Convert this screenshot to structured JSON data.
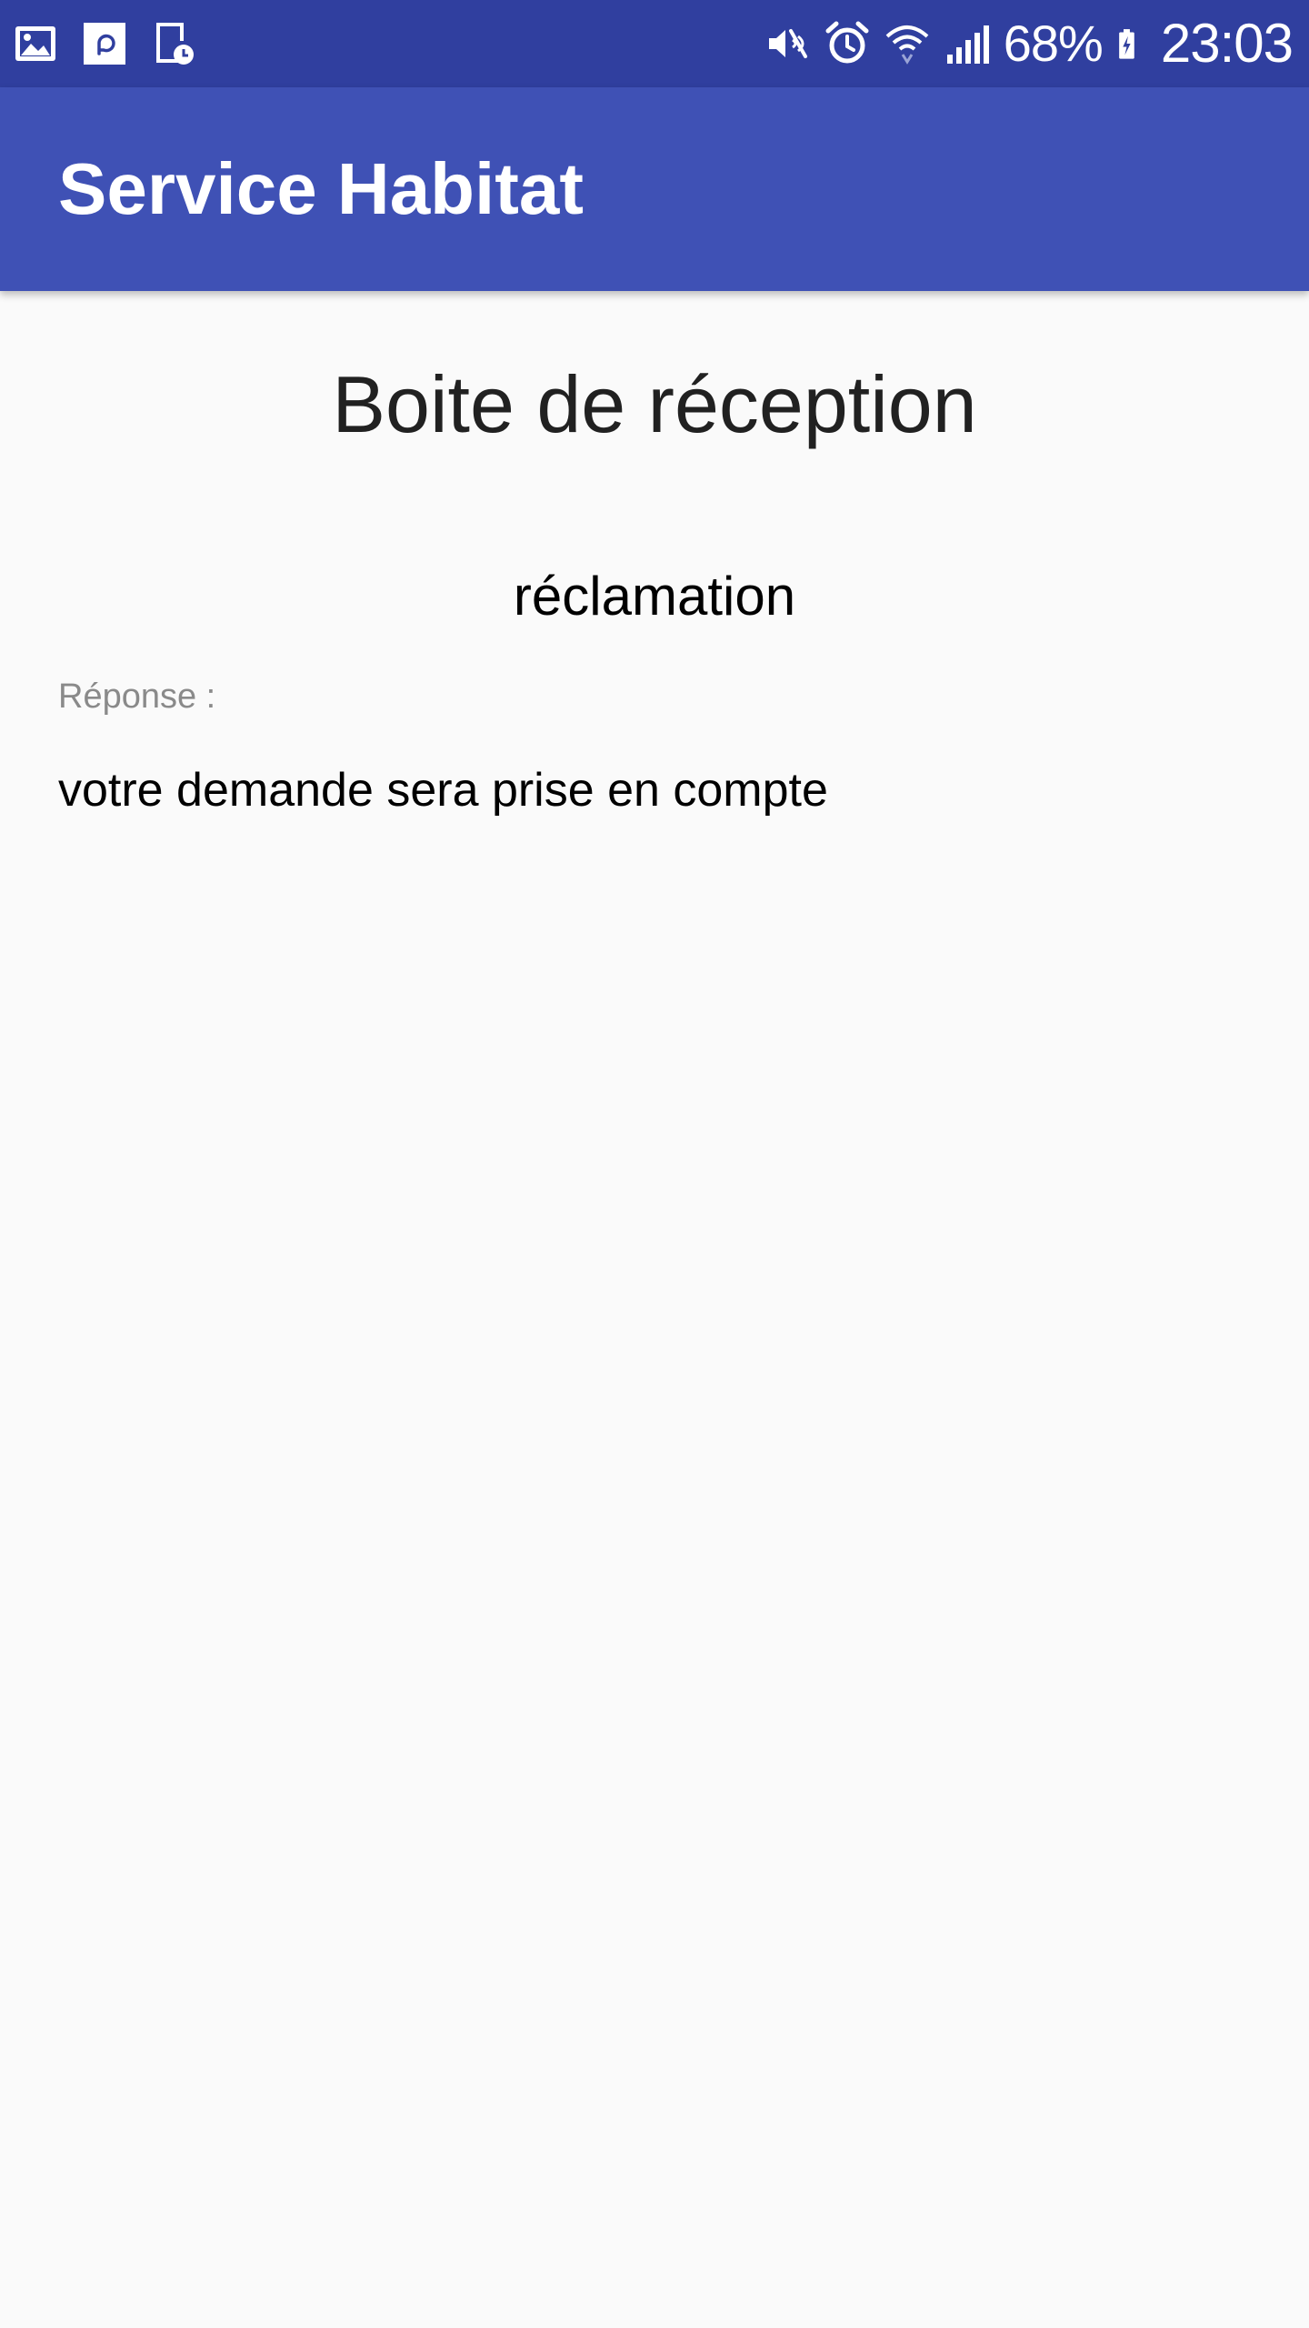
{
  "status_bar": {
    "background": "#303f9f",
    "left_icons": [
      "gallery-icon",
      "pinterest-app-icon",
      "screen-timer-icon"
    ],
    "right_icons": [
      "mute-vibrate-icon",
      "alarm-clock-icon",
      "wifi-icon",
      "signal-icon",
      "battery-charging-icon"
    ],
    "battery_percent": "68%",
    "time": "23:03"
  },
  "app_bar": {
    "background": "#3f51b5",
    "title": "Service Habitat"
  },
  "inbox": {
    "title": "Boite de réception",
    "message": {
      "subject": "réclamation",
      "response_label": "Réponse :",
      "response_text": "votre demande sera prise en compte"
    }
  }
}
